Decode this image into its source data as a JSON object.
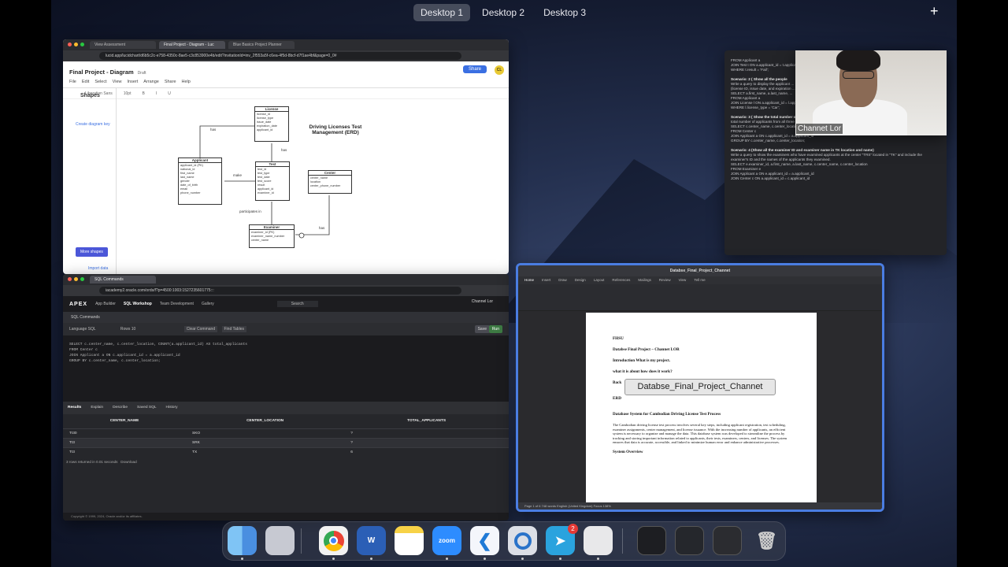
{
  "spaces": {
    "desktop1": "Desktop 1",
    "desktop2": "Desktop 2",
    "desktop3": "Desktop 3",
    "add": "+"
  },
  "lucid": {
    "tabs": [
      "View Assessment",
      "Final Project - Diagram - Luc",
      "Blue Basics Project Planner"
    ],
    "url": "lucid.app/lucidchart/d6b5c2c-e758-4350c-8ae5-c3c853900e4b/edit?invitationId=inv_2f553a5f-c6ea-4f5d-8bcf-d7f1ae4bf&page=0_0#",
    "title": "Final Project - Diagram",
    "badge": "Draft",
    "menu": [
      "File",
      "Edit",
      "Select",
      "View",
      "Insert",
      "Arrange",
      "Share",
      "Help"
    ],
    "share": "Share",
    "avatar": "CL",
    "font": "Liberation Sans",
    "fontsize": "10pt",
    "shapes": "Shapes",
    "create": "Create diagram key",
    "more_shapes": "More shapes",
    "import": "Import data",
    "erd_title": "Driving Licenses Test Management (ERD)",
    "license": {
      "title": "License",
      "fields": [
        "license_id",
        "license_type",
        "issue_date",
        "expiration_date",
        "applicant_id"
      ]
    },
    "applicant": {
      "title": "Applicant",
      "fields": [
        "applicant_id (PK)",
        "national_id",
        "first_name",
        "last_name",
        "gender",
        "date_of_birth",
        "email",
        "phone_number"
      ]
    },
    "test": {
      "title": "Test",
      "fields": [
        "test_id",
        "test_type",
        "test_date",
        "test_score",
        "result",
        "applicant_id",
        "examiner_id"
      ]
    },
    "center": {
      "title": "Center",
      "fields": [
        "center_name",
        "location",
        "center_phone_number"
      ]
    },
    "examiner": {
      "title": "Examiner",
      "fields": [
        "examiner_id (PK)",
        "examiner_name_number",
        "center_name"
      ]
    },
    "rel_has1": "has",
    "rel_has2": "has",
    "rel_makes": "make",
    "rel_has3": "has",
    "rel_part": "participates in"
  },
  "apex": {
    "tabs": [
      "SQL Commands"
    ],
    "url": "iacademy2.oracle.com/ords/f?p=4500:1003:1527235601775:::",
    "logo": "APEX",
    "nav": [
      "App Builder",
      "SQL Workshop",
      "Team Development",
      "Gallery"
    ],
    "search": "Search",
    "user": "Channel Lor",
    "crumb": "SQL Commands",
    "schema": "WKSP_CHANNEL",
    "language": "Language SQL",
    "rows": "Rows 10",
    "clear": "Clear Command",
    "find": "Find Tables",
    "save": "Save",
    "run": "Run",
    "code": [
      "SELECT c.center_name, c.center_location, COUNT(a.applicant_id) AS total_applicants",
      "FROM Center c",
      "JOIN Applicant a ON c.applicant_id = a.applicant_id",
      "GROUP BY c.center_name, c.center_location;"
    ],
    "restabs": [
      "Results",
      "Explain",
      "Describe",
      "Saved SQL",
      "History"
    ],
    "columns": [
      "CENTER_NAME",
      "CENTER_LOCATION",
      "TOTAL_APPLICANTS"
    ],
    "rows_data": [
      [
        "TI30",
        "SKO",
        "?"
      ],
      [
        "TI3",
        "SRK",
        "?"
      ],
      [
        "TI3",
        "TX",
        "6"
      ]
    ],
    "rows_returned": "3 rows returned in 0.01 seconds",
    "download": "Download",
    "footer": "Copyright © 1999, 2024, Oracle and/or its affiliates."
  },
  "sqltext": {
    "lines": [
      {
        "t": "FROM Applicant a",
        "b": false
      },
      {
        "t": "JOIN Test t ON a.applicant_id = t.applicant_id",
        "b": false
      },
      {
        "t": "WHERE t.result = 'Fail';",
        "b": false
      },
      {
        "t": "Scenario: 2 ( Show all the people",
        "b": true
      },
      {
        "t": "Write a query to display the applicant ...",
        "b": false
      },
      {
        "t": "(license ID, issue date, and expiration ...",
        "b": false
      },
      {
        "t": "SELECT a.first_name, a.last_name, ...",
        "b": false
      },
      {
        "t": "FROM Applicant a",
        "b": false
      },
      {
        "t": "JOIN License l ON a.applicant_id = l.applicant_id",
        "b": false
      },
      {
        "t": "WHERE l.license_type = 'Car';",
        "b": false
      },
      {
        "t": "Scenario: 3 ( Show the total number of people in each center_location)",
        "b": true
      },
      {
        "t": "total number of applicants from all three centers, you can use the following query:",
        "b": false
      },
      {
        "t": "SELECT c.center_name, c.center_location, COUNT(a.applicant_id) AS total_applicants",
        "b": false
      },
      {
        "t": "FROM Center c",
        "b": false
      },
      {
        "t": "JOIN Applicant a ON c.applicant_id = a.applicant_id",
        "b": false
      },
      {
        "t": "GROUP BY c.center_name, c.center_location;",
        "b": false
      },
      {
        "t": "Scenario: 4 (Show all the examiner ID and examiner name in TK location and name)",
        "b": true
      },
      {
        "t": "Write a query to show the examiners who have examined applicants at the center \"TRS\" located in \"TK\" and include the examiner's ID and the names of the applicants they examined.",
        "b": false
      },
      {
        "t": "SELECT e.examiner_id, a.first_name, a.last_name, c.center_name, c.center_location",
        "b": false
      },
      {
        "t": "FROM Examiner e",
        "b": false
      },
      {
        "t": "JOIN Applicant a ON e.applicant_id = a.applicant_id",
        "b": false
      },
      {
        "t": "JOIN Center c ON a.applicant_id = c.applicant_id",
        "b": false
      }
    ]
  },
  "webcam": {
    "name": "Channet Lor"
  },
  "word": {
    "title": "Databse_Final_Project_Channet",
    "rtabs": [
      "Home",
      "Insert",
      "Draw",
      "Design",
      "Layout",
      "References",
      "Mailings",
      "Review",
      "View",
      "Tell me"
    ],
    "lines": [
      "FHSU",
      "Databse Final Project – Channet LOR",
      "Introduction What is my project.",
      "what it is about how does it work?",
      "Back",
      "ERD",
      "Database System for Cambodian Driving License Test Process"
    ],
    "para": "The Cambodian driving license test process involves several key steps, including applicant registration, test scheduling, examiner assignments, center management, and license issuance. With the increasing number of applicants, an efficient system is necessary to organize and manage the data. This database system was developed to streamline the process by tracking and storing important information related to applicants, their tests, examiners, centers, and licenses. The system ensures that data is accurate, accessible, and linked to minimize human error and enhance administrative processes.",
    "overview": "System Overview",
    "status": "Page 1 of 6    748 words    English (United Kingdom)    Focus    138%",
    "tooltip": "Databse_Final_Project_Channet"
  },
  "dock": {
    "items": [
      "finder",
      "launchpad",
      "chrome",
      "word",
      "notes",
      "zoom",
      "vscode",
      "quicktime",
      "telegram",
      "preview",
      "window1",
      "window2",
      "window3",
      "trash"
    ],
    "labels": {
      "word": "W",
      "zoom": "zoom",
      "telegram_badge": "2"
    }
  }
}
